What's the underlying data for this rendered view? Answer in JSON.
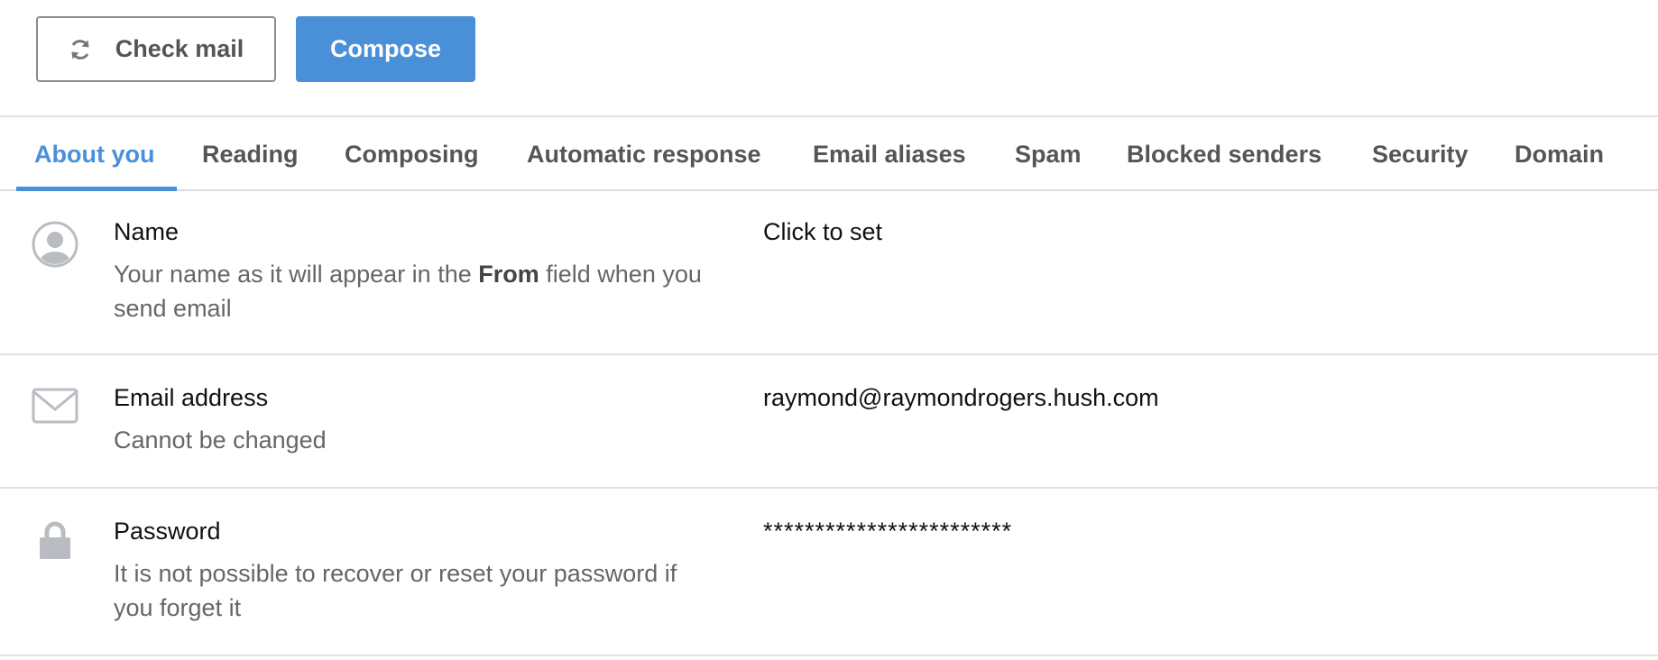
{
  "toolbar": {
    "check_mail_label": "Check mail",
    "compose_label": "Compose",
    "check_mail_icon": "refresh-icon",
    "accent_color": "#4a90d9"
  },
  "tabs": [
    {
      "label": "About you",
      "active": true
    },
    {
      "label": "Reading",
      "active": false
    },
    {
      "label": "Composing",
      "active": false
    },
    {
      "label": "Automatic response",
      "active": false
    },
    {
      "label": "Email aliases",
      "active": false
    },
    {
      "label": "Spam",
      "active": false
    },
    {
      "label": "Blocked senders",
      "active": false
    },
    {
      "label": "Security",
      "active": false
    },
    {
      "label": "Domain",
      "active": false
    }
  ],
  "settings": {
    "name": {
      "icon": "user-avatar-icon",
      "title": "Name",
      "desc_before": "Your name as it will appear in the ",
      "desc_bold": "From",
      "desc_after": " field when you send email",
      "value": "Click to set"
    },
    "email": {
      "icon": "envelope-icon",
      "title": "Email address",
      "desc": "Cannot be changed",
      "value": "raymond@raymondrogers.hush.com"
    },
    "password": {
      "icon": "lock-icon",
      "title": "Password",
      "desc": "It is not possible to recover or reset your password if you forget it",
      "value": "************************"
    }
  }
}
